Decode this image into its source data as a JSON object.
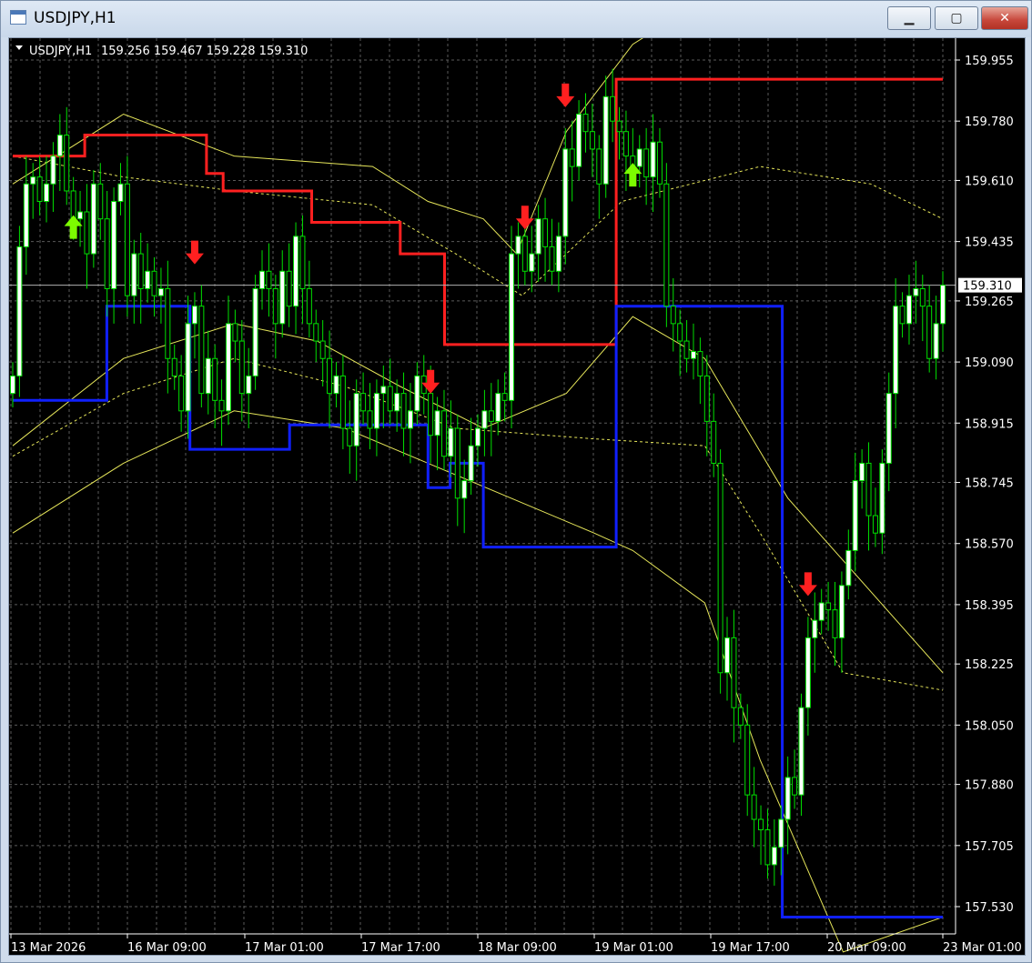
{
  "window": {
    "title": "USDJPY,H1",
    "buttons": {
      "minimize": "▁",
      "maximize": "▢",
      "close": "✕"
    }
  },
  "chart_header": {
    "symbol_tf": "USDJPY,H1",
    "ohlc": "159.256 159.467 159.228 159.310"
  },
  "colors": {
    "background": "#000000",
    "grid": "#5a5a5a",
    "candle_bull": "#ffffff",
    "candle_border": "#00e000",
    "upper_channel": "#ff2020",
    "lower_channel": "#1020ff",
    "bands": "#e6e65a",
    "buy_arrow": "#7cfc00",
    "sell_arrow": "#ff2020",
    "axis_text": "#ffffff"
  },
  "chart_data": {
    "type": "candlestick",
    "symbol": "USDJPY",
    "timeframe": "H1",
    "last_price": 159.31,
    "ylim": [
      157.45,
      160.09
    ],
    "y_ticks": [
      "159.955",
      "159.780",
      "159.610",
      "159.435",
      "159.265",
      "159.090",
      "158.915",
      "158.745",
      "158.570",
      "158.395",
      "158.225",
      "158.050",
      "157.880",
      "157.705",
      "157.530"
    ],
    "x_ticks": [
      "13 Mar 2026",
      "16 Mar 09:00",
      "17 Mar 01:00",
      "17 Mar 17:00",
      "18 Mar 09:00",
      "19 Mar 01:00",
      "19 Mar 17:00",
      "20 Mar 09:00",
      "23 Mar 01:00"
    ],
    "grid": true,
    "closes": [
      159.05,
      159.42,
      159.6,
      159.62,
      159.55,
      159.6,
      159.68,
      159.74,
      159.58,
      159.5,
      159.52,
      159.4,
      159.6,
      159.5,
      159.3,
      159.55,
      159.6,
      159.28,
      159.4,
      159.3,
      159.35,
      159.28,
      159.3,
      159.1,
      159.05,
      158.95,
      159.2,
      159.25,
      159.0,
      159.1,
      158.98,
      158.95,
      159.2,
      159.15,
      159.0,
      159.05,
      159.3,
      159.35,
      159.3,
      159.2,
      159.35,
      159.25,
      159.45,
      159.3,
      159.2,
      159.15,
      159.1,
      159.0,
      159.05,
      158.9,
      158.85,
      159.0,
      158.95,
      158.9,
      159.0,
      159.02,
      158.95,
      159.0,
      158.9,
      158.95,
      159.05,
      159.0,
      158.88,
      158.95,
      158.82,
      158.9,
      158.7,
      158.75,
      158.85,
      158.9,
      158.95,
      158.92,
      159.0,
      158.98,
      159.4,
      159.45,
      159.35,
      159.4,
      159.5,
      159.42,
      159.35,
      159.45,
      159.7,
      159.65,
      159.8,
      159.75,
      159.7,
      159.6,
      159.85,
      159.78,
      159.75,
      159.68,
      159.65,
      159.7,
      159.62,
      159.72,
      159.6,
      159.25,
      159.2,
      159.15,
      159.1,
      159.12,
      159.05,
      158.92,
      158.8,
      158.2,
      158.3,
      158.1,
      158.05,
      157.85,
      157.78,
      157.75,
      157.65,
      157.7,
      157.78,
      157.9,
      157.85,
      158.1,
      158.3,
      158.35,
      158.4,
      158.38,
      158.3,
      158.45,
      158.55,
      158.75,
      158.8,
      158.65,
      158.6,
      158.8,
      159.0,
      159.25,
      159.2,
      159.28,
      159.3,
      159.25,
      159.1,
      159.2,
      159.31
    ],
    "upper_channel": [
      [
        0,
        159.68
      ],
      [
        13,
        159.68
      ],
      [
        13,
        159.74
      ],
      [
        35,
        159.74
      ],
      [
        35,
        159.63
      ],
      [
        38,
        159.63
      ],
      [
        38,
        159.58
      ],
      [
        54,
        159.58
      ],
      [
        54,
        159.49
      ],
      [
        70,
        159.49
      ],
      [
        70,
        159.4
      ],
      [
        78,
        159.4
      ],
      [
        78,
        159.14
      ],
      [
        109,
        159.14
      ],
      [
        109,
        159.9
      ],
      [
        168,
        159.9
      ]
    ],
    "lower_channel": [
      [
        0,
        158.98
      ],
      [
        17,
        158.98
      ],
      [
        17,
        159.25
      ],
      [
        32,
        159.25
      ],
      [
        32,
        158.84
      ],
      [
        50,
        158.84
      ],
      [
        50,
        158.91
      ],
      [
        75,
        158.91
      ],
      [
        75,
        158.73
      ],
      [
        79,
        158.73
      ],
      [
        79,
        158.8
      ],
      [
        85,
        158.8
      ],
      [
        85,
        158.56
      ],
      [
        109,
        158.56
      ],
      [
        109,
        159.25
      ],
      [
        139,
        159.25
      ],
      [
        139,
        157.5
      ],
      [
        168,
        157.5
      ]
    ],
    "band_upper": [
      [
        0,
        159.6
      ],
      [
        20,
        159.8
      ],
      [
        40,
        159.68
      ],
      [
        65,
        159.65
      ],
      [
        75,
        159.55
      ],
      [
        85,
        159.5
      ],
      [
        91,
        159.4
      ],
      [
        100,
        159.75
      ],
      [
        112,
        160.0
      ],
      [
        121,
        160.09
      ],
      [
        168,
        160.09
      ]
    ],
    "band_mid": [
      [
        0,
        158.85
      ],
      [
        20,
        159.1
      ],
      [
        40,
        159.2
      ],
      [
        55,
        159.15
      ],
      [
        70,
        159.02
      ],
      [
        85,
        158.9
      ],
      [
        100,
        159.0
      ],
      [
        112,
        159.22
      ],
      [
        125,
        159.1
      ],
      [
        140,
        158.7
      ],
      [
        168,
        158.2
      ]
    ],
    "band_lower": [
      [
        0,
        158.6
      ],
      [
        20,
        158.8
      ],
      [
        40,
        158.95
      ],
      [
        60,
        158.9
      ],
      [
        75,
        158.8
      ],
      [
        90,
        158.7
      ],
      [
        105,
        158.6
      ],
      [
        112,
        158.55
      ],
      [
        125,
        158.4
      ],
      [
        135,
        157.95
      ],
      [
        150,
        157.4
      ],
      [
        168,
        157.5
      ]
    ],
    "ma_dotted_upper": [
      [
        0,
        159.68
      ],
      [
        20,
        159.62
      ],
      [
        40,
        159.58
      ],
      [
        65,
        159.54
      ],
      [
        80,
        159.4
      ],
      [
        92,
        159.28
      ],
      [
        110,
        159.55
      ],
      [
        135,
        159.65
      ],
      [
        155,
        159.6
      ],
      [
        168,
        159.5
      ]
    ],
    "ma_dotted_lower": [
      [
        0,
        158.82
      ],
      [
        20,
        159.0
      ],
      [
        40,
        159.1
      ],
      [
        60,
        159.02
      ],
      [
        80,
        158.9
      ],
      [
        105,
        158.87
      ],
      [
        125,
        158.85
      ],
      [
        135,
        158.6
      ],
      [
        150,
        158.2
      ],
      [
        168,
        158.15
      ]
    ],
    "buy_signals": [
      9,
      92
    ],
    "sell_signals": [
      27,
      62,
      76,
      82,
      118
    ]
  }
}
